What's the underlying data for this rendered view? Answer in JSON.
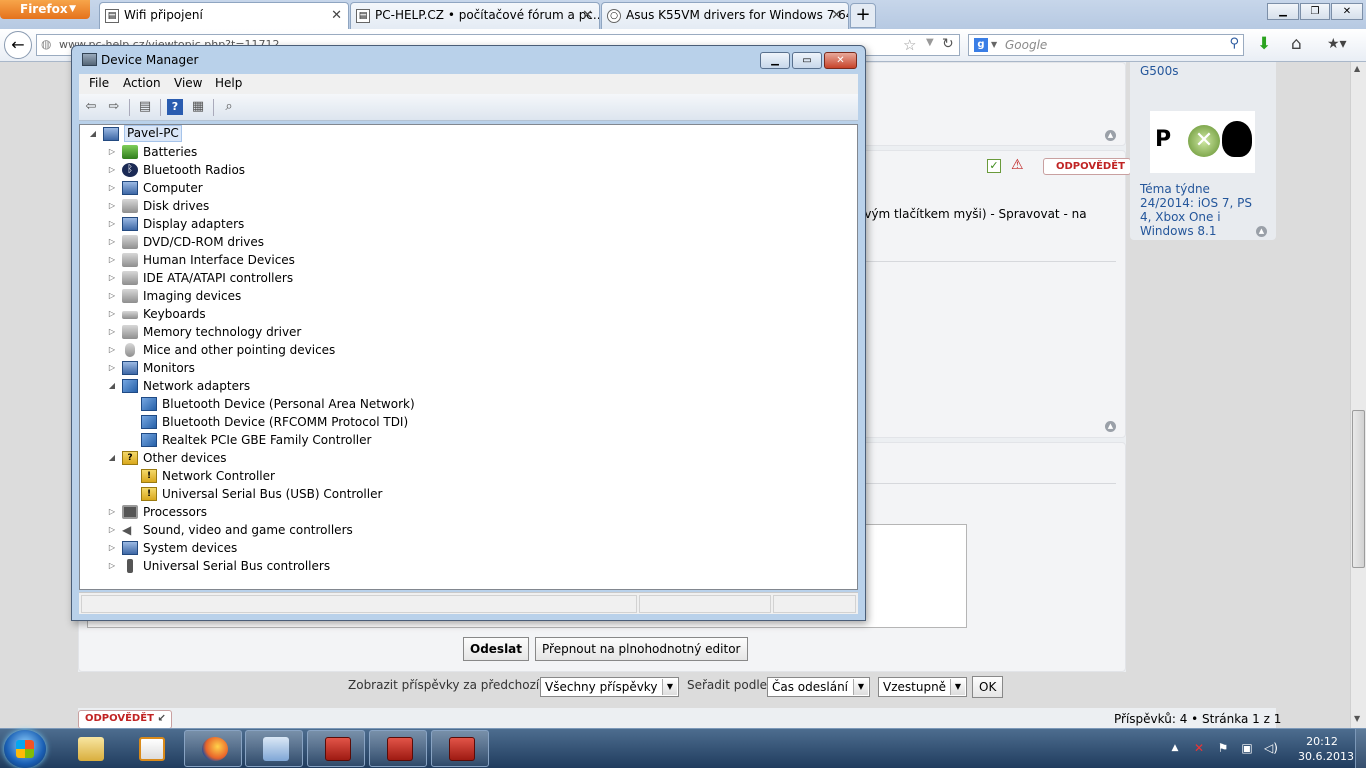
{
  "firefox": {
    "button_label": "Firefox",
    "tabs": [
      {
        "label": "Wifi připojení",
        "icon": "page-icon"
      },
      {
        "label": "PC-HELP.CZ • počítačové fórum a pc...",
        "icon": "page-icon"
      },
      {
        "label": "Asus K55VM drivers for Windows 7 64...",
        "icon": "page-icon"
      }
    ],
    "new_tab_label": "+",
    "url": "www.pc-help.cz/viewtopic.php?t=11712",
    "search_placeholder": "Google",
    "search_engine_letter": "g"
  },
  "page": {
    "sidebar": {
      "top_link": "G500s",
      "article_link": "Téma týdne 24/2014: iOS 7, PS 4, Xbox One i Windows 8.1"
    },
    "reply_label": "ODPOVĚDĚT",
    "post_text_fragment": "avým tlačítkem myši) - Spravovat - na",
    "send_button": "Odeslat",
    "full_editor_button": "Přepnout na plnohodnotný editor",
    "filters": {
      "show_label": "Zobrazit příspěvky za předchozí:",
      "show_value": "Všechny příspěvky",
      "sort_label": "Seřadit podle",
      "sort_value": "Čas odeslání",
      "order_value": "Vzestupně",
      "ok_label": "OK"
    },
    "pagination": "Příspěvků: 4 • Stránka 1 z 1",
    "reply_bottom_label": "ODPOVĚDĚT"
  },
  "device_manager": {
    "title": "Device Manager",
    "menu": [
      "File",
      "Action",
      "View",
      "Help"
    ],
    "root": "Pavel-PC",
    "categories": [
      {
        "label": "Batteries",
        "icon": "battery-icon",
        "expanded": false,
        "children": []
      },
      {
        "label": "Bluetooth Radios",
        "icon": "bluetooth-icon",
        "expanded": false,
        "children": []
      },
      {
        "label": "Computer",
        "icon": "computer-icon",
        "expanded": false,
        "children": []
      },
      {
        "label": "Disk drives",
        "icon": "disk-drive-icon",
        "expanded": false,
        "children": []
      },
      {
        "label": "Display adapters",
        "icon": "display-adapter-icon",
        "expanded": false,
        "children": []
      },
      {
        "label": "DVD/CD-ROM drives",
        "icon": "dvd-drive-icon",
        "expanded": false,
        "children": []
      },
      {
        "label": "Human Interface Devices",
        "icon": "hid-icon",
        "expanded": false,
        "children": []
      },
      {
        "label": "IDE ATA/ATAPI controllers",
        "icon": "ide-controller-icon",
        "expanded": false,
        "children": []
      },
      {
        "label": "Imaging devices",
        "icon": "camera-icon",
        "expanded": false,
        "children": []
      },
      {
        "label": "Keyboards",
        "icon": "keyboard-icon",
        "expanded": false,
        "children": []
      },
      {
        "label": "Memory technology driver",
        "icon": "memory-icon",
        "expanded": false,
        "children": []
      },
      {
        "label": "Mice and other pointing devices",
        "icon": "mouse-icon",
        "expanded": false,
        "children": []
      },
      {
        "label": "Monitors",
        "icon": "monitor-icon",
        "expanded": false,
        "children": []
      },
      {
        "label": "Network adapters",
        "icon": "network-adapter-icon",
        "expanded": true,
        "children": [
          "Bluetooth Device (Personal Area Network)",
          "Bluetooth Device (RFCOMM Protocol TDI)",
          "Realtek PCIe GBE Family Controller"
        ]
      },
      {
        "label": "Other devices",
        "icon": "unknown-device-icon",
        "expanded": true,
        "children": [
          "Network Controller",
          "Universal Serial Bus (USB) Controller"
        ]
      },
      {
        "label": "Processors",
        "icon": "processor-icon",
        "expanded": false,
        "children": []
      },
      {
        "label": "Sound, video and game controllers",
        "icon": "speaker-icon",
        "expanded": false,
        "children": []
      },
      {
        "label": "System devices",
        "icon": "system-device-icon",
        "expanded": false,
        "children": []
      },
      {
        "label": "Universal Serial Bus controllers",
        "icon": "usb-icon",
        "expanded": false,
        "children": []
      }
    ]
  },
  "taskbar": {
    "time": "20:12",
    "date": "30.6.2013",
    "apps": [
      "folder-icon",
      "media-player-icon",
      "firefox-icon",
      "control-panel-icon",
      "toolbox-icon",
      "toolbox-icon",
      "toolbox-icon"
    ]
  }
}
